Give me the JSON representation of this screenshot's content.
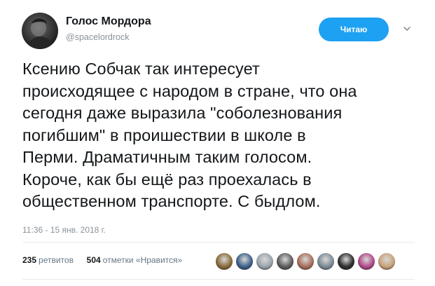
{
  "user": {
    "name": "Голос Мордора",
    "handle": "@spacelordrock"
  },
  "follow_button": {
    "label": "Читаю",
    "color": "#1da1f2"
  },
  "caret_icon": "chevron-down-icon",
  "tweet": {
    "text": "Ксению Собчак так интересует\nпроисходящее с народом в стране, что она\nсегодня даже выразила \"соболезнования\nпогибшим\" в проишествии в школе в\nПерми. Драматичным таким голосом.\nКороче, как бы ещё раз проехалась в\nобщественном транспорте. С быдлом.",
    "timestamp": "11:36 - 15 янв. 2018 г."
  },
  "stats": {
    "retweets_count": "235",
    "retweets_label": "ретвитов",
    "likes_count": "504",
    "likes_label": "отметки «Нравится»"
  },
  "likers": [
    {
      "name": "liker-avatar-1",
      "color": "#8a6a3a"
    },
    {
      "name": "liker-avatar-2",
      "color": "#3e5f8a"
    },
    {
      "name": "liker-avatar-3",
      "color": "#9aa4ad"
    },
    {
      "name": "liker-avatar-4",
      "color": "#5c5c5c"
    },
    {
      "name": "liker-avatar-5",
      "color": "#a86e5a"
    },
    {
      "name": "liker-avatar-6",
      "color": "#7d8b96"
    },
    {
      "name": "liker-avatar-7",
      "color": "#2e2e2e"
    },
    {
      "name": "liker-avatar-8",
      "color": "#b04a8a"
    },
    {
      "name": "liker-avatar-9",
      "color": "#c9a27a"
    }
  ]
}
